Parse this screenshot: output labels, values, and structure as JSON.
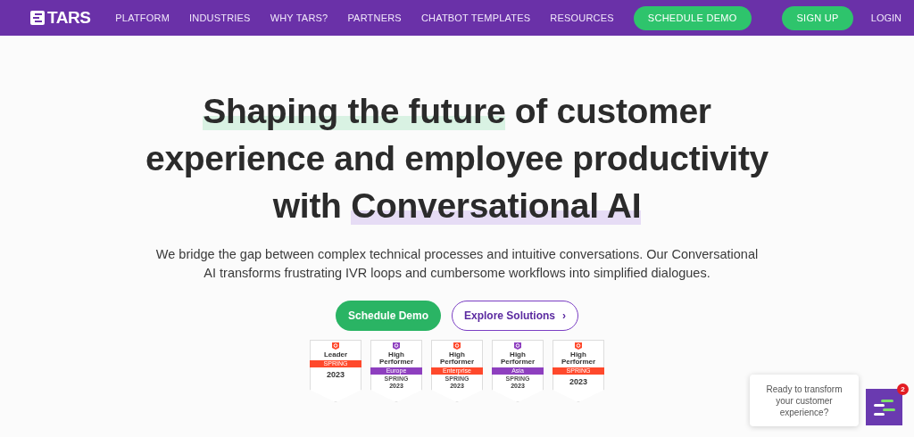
{
  "nav": {
    "logo": "TARS",
    "links": [
      "PLATFORM",
      "INDUSTRIES",
      "WHY TARS?",
      "PARTNERS",
      "CHATBOT TEMPLATES",
      "RESOURCES"
    ],
    "demo_button": "SCHEDULE DEMO",
    "signup_button": "SIGN UP",
    "login": "LOGIN"
  },
  "hero": {
    "heading_lines": [
      [
        {
          "text": "Shaping the future",
          "color": "#d9f2e3"
        },
        {
          "text": " of customer"
        }
      ],
      [
        {
          "text": "experience and employee productivity"
        }
      ],
      [
        {
          "text": "with "
        },
        {
          "text": "Conversational AI",
          "color": "#e6dcf5"
        }
      ]
    ],
    "paragraph": "We bridge the gap between complex technical processes and intuitive conversations. Our Conversational AI transforms frustrating IVR loops and cumbersome workflows into simplified dialogues.",
    "primary_button": "Schedule Demo",
    "secondary_button": "Explore Solutions",
    "secondary_chevron": "›"
  },
  "badges": [
    {
      "title": "Leader",
      "ribbon": "SPRING",
      "year": "2023",
      "color": "#ff492c"
    },
    {
      "title": "High Performer",
      "ribbon": "Europe",
      "season": "SPRING",
      "year": "2023",
      "color": "#8e3fbf"
    },
    {
      "title": "High Performer",
      "ribbon": "Enterprise",
      "season": "SPRING",
      "year": "2023",
      "color": "#ff492c"
    },
    {
      "title": "High Performer",
      "ribbon": "Asia",
      "season": "SPRING",
      "year": "2023",
      "color": "#8e3fbf"
    },
    {
      "title": "High Performer",
      "ribbon": "SPRING",
      "year": "2023",
      "color": "#ff492c"
    }
  ],
  "chat": {
    "prompt": "Ready to transform your customer experience?",
    "unread": "2"
  }
}
